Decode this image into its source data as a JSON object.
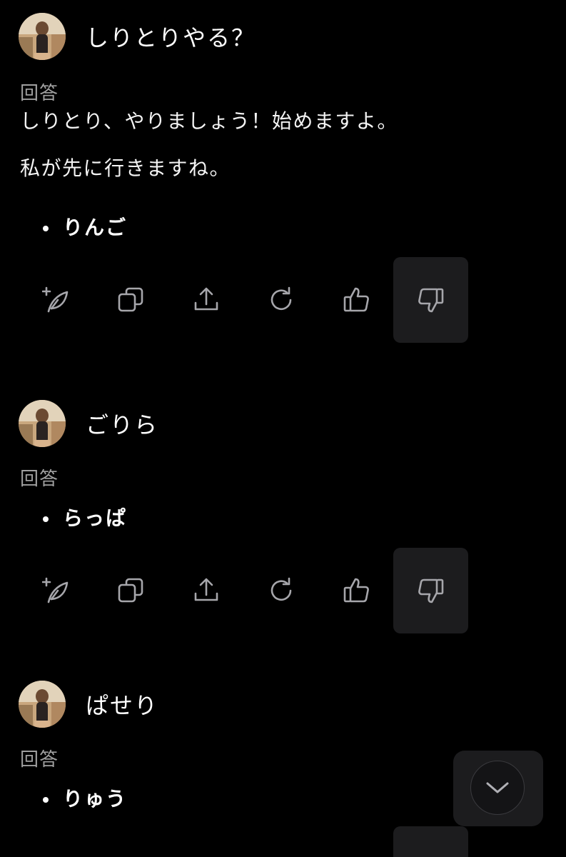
{
  "conversation": {
    "turns": [
      {
        "user_message": "しりとりやる？",
        "answer_label": "回答",
        "paragraphs": [
          "しりとり、やりましょう！始めますよ。",
          "私が先に行きますね。"
        ],
        "bullets": [
          "りんご"
        ]
      },
      {
        "user_message": "ごりら",
        "answer_label": "回答",
        "bullets": [
          "らっぱ"
        ]
      },
      {
        "user_message": "ぱせり",
        "answer_label": "回答",
        "bullets": [
          "りゅう"
        ]
      }
    ]
  },
  "toolbar": {
    "actions": [
      "add-note-icon",
      "copy-icon",
      "share-icon",
      "regenerate-icon",
      "thumbs-up-icon",
      "thumbs-down-icon"
    ],
    "active_action": "thumbs-down-icon",
    "icon_color": "#a6a6ab",
    "active_bg": "#1c1c1e"
  },
  "scroll_button": {
    "icon": "chevron-down-icon"
  }
}
